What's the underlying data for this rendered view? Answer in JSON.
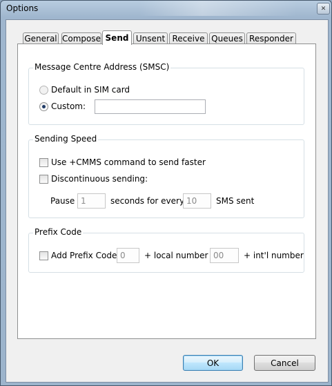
{
  "window": {
    "title": "Options",
    "close_symbol": "✕"
  },
  "tabs": [
    {
      "label": "General",
      "active": false
    },
    {
      "label": "Compose",
      "active": false
    },
    {
      "label": "Send",
      "active": true
    },
    {
      "label": "Unsent",
      "active": false
    },
    {
      "label": "Receive",
      "active": false
    },
    {
      "label": "Queues",
      "active": false
    },
    {
      "label": "Responder",
      "active": false
    }
  ],
  "smsc": {
    "legend": "Message Centre Address (SMSC)",
    "default_label": "Default in SIM card",
    "custom_label": "Custom:",
    "custom_value": ""
  },
  "speed": {
    "legend": "Sending Speed",
    "cmms_label": "Use +CMMS command to send faster",
    "discontinuous_label": "Discontinuous sending:",
    "pause_label": "Pause",
    "pause_value": "1",
    "seconds_label": "seconds for every",
    "every_value": "10",
    "sms_sent_label": "SMS sent"
  },
  "prefix": {
    "legend": "Prefix Code",
    "add_label": "Add Prefix Code",
    "local_value": "0",
    "local_label": "+ local number",
    "intl_value": "00",
    "intl_label": "+ int'l number"
  },
  "buttons": {
    "ok": "OK",
    "cancel": "Cancel"
  }
}
